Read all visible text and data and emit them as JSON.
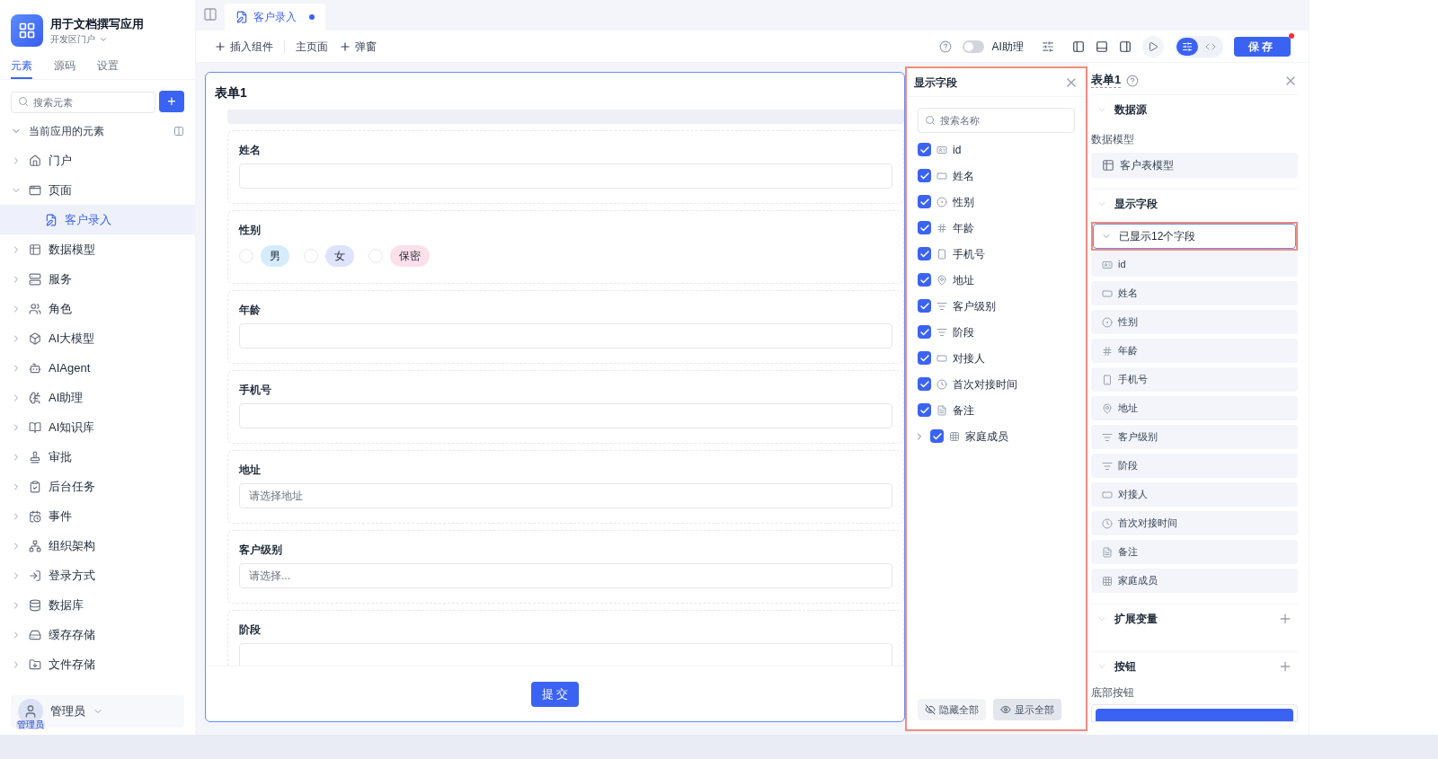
{
  "app": {
    "title": "用于文档撰写应用",
    "portal": "开发区门户"
  },
  "sidebar": {
    "tabs": [
      {
        "label": "元素",
        "selected": true
      },
      {
        "label": "源码",
        "selected": false
      },
      {
        "label": "设置",
        "selected": false
      }
    ],
    "search": {
      "placeholder": "搜索元素"
    },
    "add_button": "+",
    "section": "当前应用的元素",
    "items": [
      {
        "label": "门户",
        "expanded": false,
        "selected": false
      },
      {
        "label": "页面",
        "expanded": true,
        "selected": false,
        "children": [
          {
            "label": "客户录入",
            "selected": true
          }
        ]
      },
      {
        "label": "数据模型",
        "expanded": false,
        "selected": false
      },
      {
        "label": "服务",
        "expanded": false,
        "selected": false
      },
      {
        "label": "角色",
        "expanded": false,
        "selected": false
      },
      {
        "label": "AI大模型",
        "expanded": false,
        "selected": false
      },
      {
        "label": "AIAgent",
        "expanded": false,
        "selected": false
      },
      {
        "label": "AI助理",
        "expanded": false,
        "selected": false
      },
      {
        "label": "AI知识库",
        "expanded": false,
        "selected": false
      },
      {
        "label": "审批",
        "expanded": false,
        "selected": false
      },
      {
        "label": "后台任务",
        "expanded": false,
        "selected": false
      },
      {
        "label": "事件",
        "expanded": false,
        "selected": false
      },
      {
        "label": "组织架构",
        "expanded": false,
        "selected": false
      },
      {
        "label": "登录方式",
        "expanded": false,
        "selected": false
      },
      {
        "label": "数据库",
        "expanded": false,
        "selected": false
      },
      {
        "label": "缓存存储",
        "expanded": false,
        "selected": false
      },
      {
        "label": "文件存储",
        "expanded": false,
        "selected": false
      }
    ],
    "user": {
      "name": "管理员",
      "badge": "管理员"
    }
  },
  "editor_tabs": [
    {
      "label": "客户录入",
      "selected": true,
      "unsaved": true
    }
  ],
  "toolbar": {
    "insert": "插入组件",
    "main_page": "主页面",
    "popup": "弹窗",
    "ai_assistant": {
      "label": "AI助理",
      "on": false
    },
    "save": "保存",
    "save_alert": true,
    "view_modes": [
      {
        "selected": true
      },
      {
        "selected": false
      }
    ]
  },
  "form": {
    "title": "表单1",
    "fields": [
      {
        "kind": "input",
        "label": "姓名"
      },
      {
        "kind": "radio",
        "label": "性别",
        "options": [
          {
            "label": "男",
            "color": "#d6ebfd",
            "selected": false
          },
          {
            "label": "女",
            "color": "#dfe3fb",
            "selected": false
          },
          {
            "label": "保密",
            "color": "#fde0ea",
            "selected": false
          }
        ]
      },
      {
        "kind": "input",
        "label": "年龄"
      },
      {
        "kind": "input",
        "label": "手机号"
      },
      {
        "kind": "select",
        "label": "地址",
        "placeholder": "请选择地址"
      },
      {
        "kind": "select",
        "label": "客户级别",
        "placeholder": "请选择..."
      },
      {
        "kind": "select",
        "label": "阶段"
      }
    ],
    "submit": "提 交"
  },
  "field_panel": {
    "title": "显示字段",
    "search": {
      "placeholder": "搜索名称"
    },
    "fields": [
      {
        "kind": "id",
        "label": "id",
        "checked": true
      },
      {
        "kind": "text",
        "label": "姓名",
        "checked": true
      },
      {
        "kind": "radio",
        "label": "性别",
        "checked": true
      },
      {
        "kind": "number",
        "label": "年龄",
        "checked": true
      },
      {
        "kind": "phone",
        "label": "手机号",
        "checked": true
      },
      {
        "kind": "address",
        "label": "地址",
        "checked": true
      },
      {
        "kind": "select",
        "label": "客户级别",
        "checked": true
      },
      {
        "kind": "select",
        "label": "阶段",
        "checked": true
      },
      {
        "kind": "text",
        "label": "对接人",
        "checked": true
      },
      {
        "kind": "time",
        "label": "首次对接时间",
        "checked": true
      },
      {
        "kind": "textarea",
        "label": "备注",
        "checked": true
      },
      {
        "kind": "table",
        "label": "家庭成员",
        "checked": true,
        "expandable": true
      }
    ],
    "hide_all": "隐藏全部",
    "show_all": "显示全部"
  },
  "properties": {
    "title": "表单1",
    "data_source": {
      "heading": "数据源",
      "label": "数据模型",
      "model": "客户表模型"
    },
    "display_fields": {
      "heading": "显示字段",
      "summary": "已显示12个字段",
      "fields": [
        {
          "kind": "id",
          "label": "id"
        },
        {
          "kind": "text",
          "label": "姓名"
        },
        {
          "kind": "radio",
          "label": "性别"
        },
        {
          "kind": "number",
          "label": "年龄"
        },
        {
          "kind": "phone",
          "label": "手机号"
        },
        {
          "kind": "address",
          "label": "地址"
        },
        {
          "kind": "select",
          "label": "客户级别"
        },
        {
          "kind": "select",
          "label": "阶段"
        },
        {
          "kind": "text",
          "label": "对接人"
        },
        {
          "kind": "time",
          "label": "首次对接时间"
        },
        {
          "kind": "textarea",
          "label": "备注"
        },
        {
          "kind": "table",
          "label": "家庭成员"
        }
      ]
    },
    "ext_vars": {
      "heading": "扩展变量"
    },
    "buttons": {
      "heading": "按钮",
      "label": "底部按钮"
    }
  }
}
